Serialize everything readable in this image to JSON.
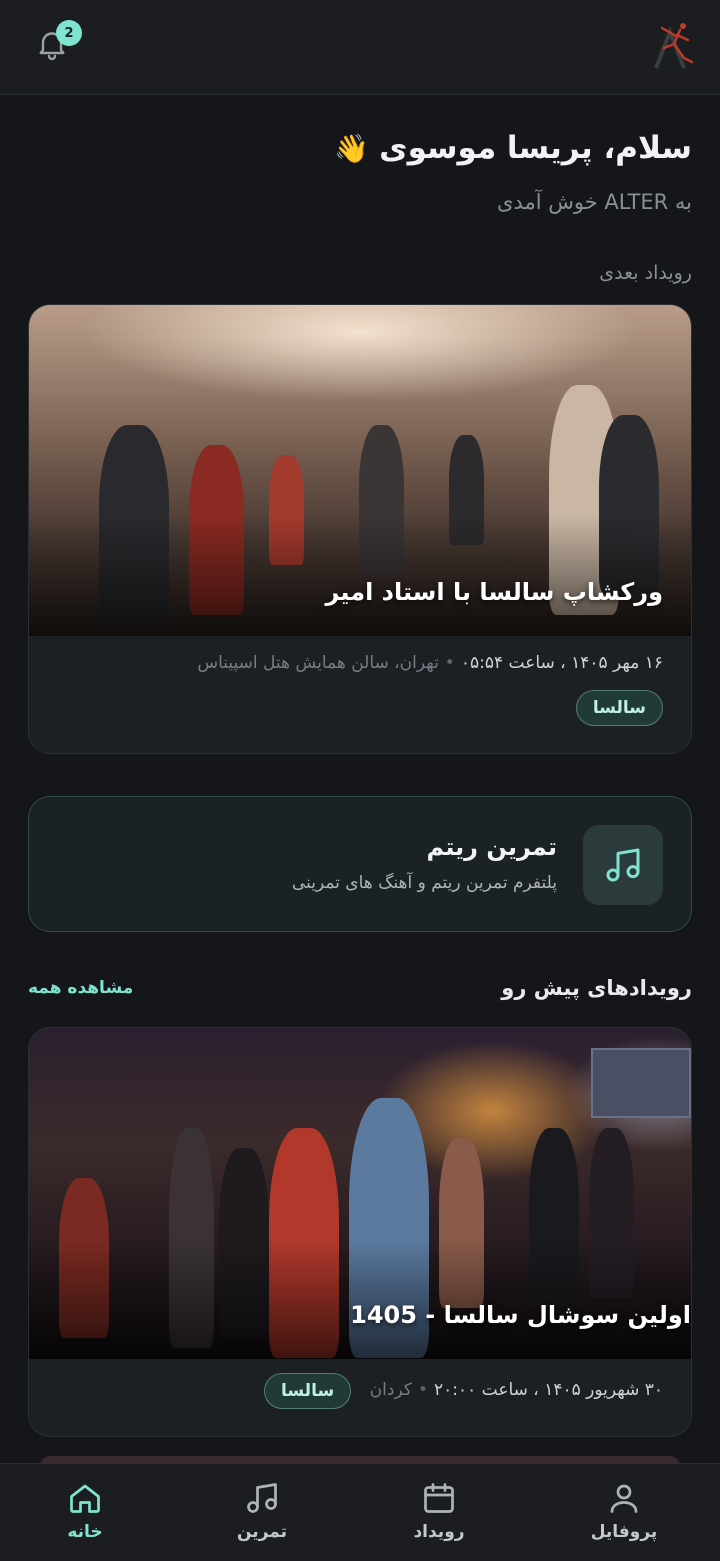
{
  "header": {
    "notification_count": "2",
    "logo": "alter-dancer-logo"
  },
  "greeting": {
    "title": "سلام، پریسا موسوی",
    "wave_emoji": "👋",
    "subtitle": "به ALTER خوش آمدی"
  },
  "next_event": {
    "section_label": "رویداد بعدی",
    "title": "ورکشاپ سالسا با استاد امیر",
    "date_time": "۱۶ مهر ۱۴۰۵ ، ساعت ۰۵:۵۴",
    "location": "تهران، سالن همایش هتل اسپیناس",
    "tag": "سالسا"
  },
  "practice": {
    "title": "تمرین ریتم",
    "subtitle": "پلتفرم تمرین ریتم و آهنگ های تمرینی",
    "icon": "music-note-icon"
  },
  "upcoming": {
    "title": "رویدادهای پیش رو",
    "see_all": "مشاهده همه",
    "events": [
      {
        "title": "اولین سوشال سالسا - 1405",
        "date_time": "۳۰ شهریور ۱۴۰۵ ، ساعت ۲۰:۰۰",
        "location": "کردان",
        "tag": "سالسا"
      }
    ]
  },
  "bottom_nav": {
    "items": [
      {
        "label": "خانه",
        "icon": "home-icon",
        "active": true
      },
      {
        "label": "تمرین",
        "icon": "music-note-icon",
        "active": false
      },
      {
        "label": "رویداد",
        "icon": "calendar-icon",
        "active": false
      },
      {
        "label": "پروفایل",
        "icon": "user-icon",
        "active": false
      }
    ]
  },
  "colors": {
    "background": "#141619",
    "accent": "#7fe3cf",
    "card": "#1c1f23"
  }
}
